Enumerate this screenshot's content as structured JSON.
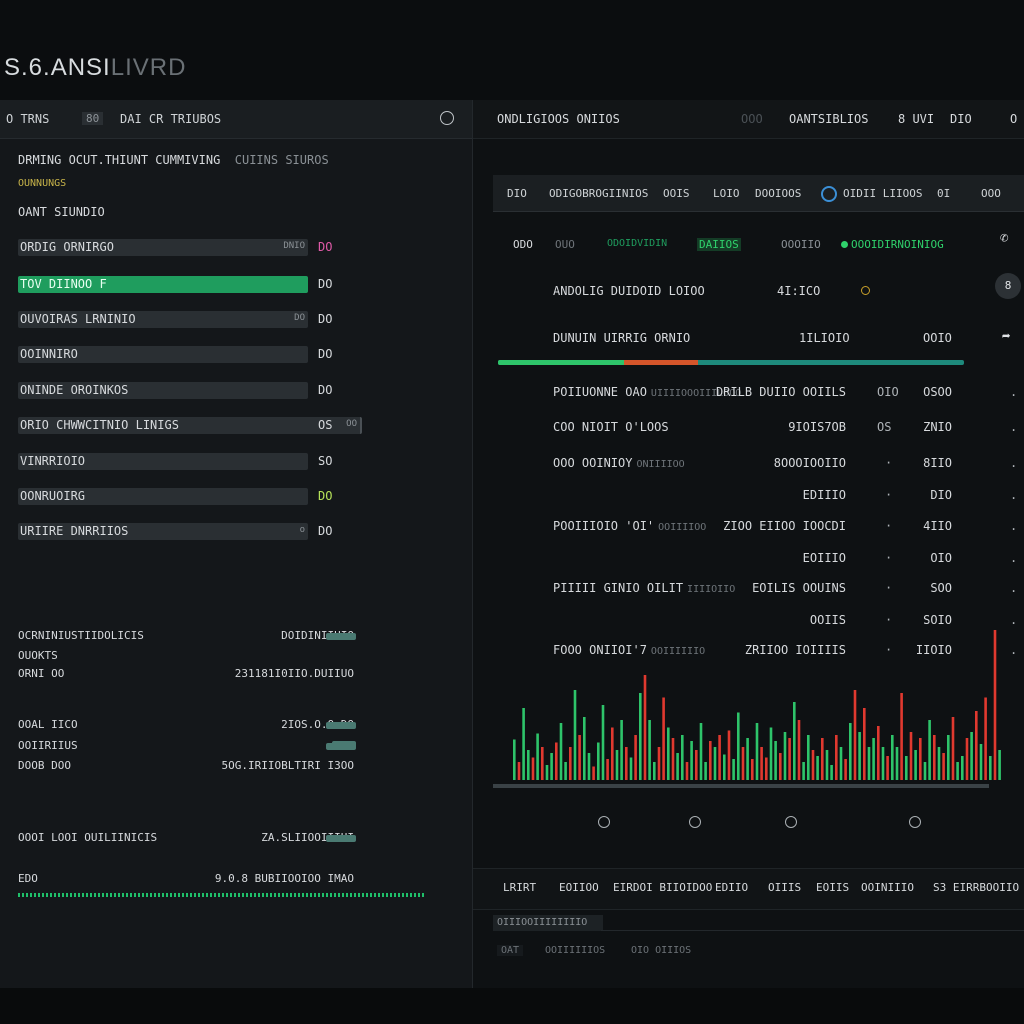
{
  "app": {
    "title": "S.6.ANSI",
    "title_faded": "LIVRD"
  },
  "left_panel": {
    "header": {
      "tab": "O TRNS",
      "badge": "80",
      "title": "DAI CR TRIUBOS",
      "icon": "gear-icon"
    },
    "heading": "DRMING OCUT.THIUNT CUMMIVING",
    "heading_extra": "CUIINS  SIUROS",
    "subheading": "OUNNUNGS",
    "section_title": "OANT SIUNDIO",
    "rows": [
      {
        "label": "ORDIG ORNIRGO",
        "sub": "DNIO",
        "value": "DO",
        "value_color": "pink"
      },
      {
        "label": "TOV DIINOO F",
        "sub": "",
        "value": "DO",
        "active": true
      },
      {
        "label": "OUVOIRAS LRNINIO",
        "sub": "DO",
        "value": "DO"
      },
      {
        "label": "OOINNIRO",
        "sub": "",
        "value": "DO"
      },
      {
        "label": "ONINDE OROINKOS",
        "sub": "",
        "value": "DO"
      },
      {
        "label": "ORIO CHWWCITNIO LINIGS",
        "sub": "OO",
        "value": "OS"
      },
      {
        "label": "VINRRIOIO",
        "sub": "",
        "value": "SO"
      },
      {
        "label": "OONRUOIRG",
        "sub": "",
        "value": "DO",
        "value_color": "lime"
      },
      {
        "label": "URIIRE DNRRIIOS",
        "sub": "o",
        "value": "DO"
      }
    ],
    "stats": [
      {
        "label": "OCRNINIUSTIIDOLICIS",
        "value": "DOIDINIIUIO"
      },
      {
        "label": "OUOKTS",
        "value": ""
      },
      {
        "label": "ORNI OO",
        "value": "231181I0IIO.DUIIUO"
      },
      {
        "label": "OOAL IICO",
        "value": "2IOS.O.O.DO"
      },
      {
        "label": "OOIIRIIUS",
        "value": ""
      },
      {
        "label": "DOOB DOO",
        "value": "5OG.IRIIOBLTIRI I3OO"
      },
      {
        "label": "OOOI LOOI OUILIINICIS",
        "value": "ZA.SLIIOOIIIUI"
      },
      {
        "label": "EDO",
        "value": "9.0.8  BUBIIOOIOO IMAO"
      }
    ]
  },
  "right_panel": {
    "header": {
      "title": "ONDLIGIOOS ONIIOS",
      "h2": "OOO",
      "h3": "OANTSIBLIOS",
      "h4": "8 UVI",
      "h5": "DIO",
      "h6": "O"
    },
    "tabs": [
      "DIO",
      "ODIGOBROGIINIOS",
      "OOIS",
      "LOIO",
      "DOOIOOS",
      "OIDII LIIOOS",
      "0I",
      "OOO"
    ],
    "filters": [
      "ODO",
      "OUO",
      "ODOIDVIDIN",
      "DAIIOS",
      "OOOIIO",
      "OOOIDIRNOINIOG"
    ],
    "summary": [
      {
        "label": "ANDOLIG DUIDOID LOIOO",
        "value": "4I:ICO"
      },
      {
        "label": "DUNUIN UIRRIG ORNIO",
        "value": "1ILIOIO",
        "value2": "OOIO"
      }
    ],
    "table": [
      {
        "name": "POIIUONNE OAO",
        "name_dim": "UIIIIOOOIIILOOO",
        "c1": "DRILB DUIIO OOIILS",
        "c2": "OIO",
        "c3": "OSOO"
      },
      {
        "name": "COO NIOIT O'LOOS",
        "name_dim": "",
        "c1": "9IOIS7OB",
        "c2": "OS",
        "c3": "ZNIO"
      },
      {
        "name": "OOO OOINIOY",
        "name_dim": "ONIIIIOO",
        "c1": "8OOOIOOIIO",
        "c2": "·",
        "c3": "8IIO"
      },
      {
        "name": "",
        "name_dim": "",
        "c1": "EDIIIO",
        "c2": "·",
        "c3": "DIO"
      },
      {
        "name": "POOIIIOIO 'OI'",
        "name_dim": "OOIIIIOO",
        "c1": "ZIOO  EIIOO IOOCDI",
        "c2": "·",
        "c3": "4IIO"
      },
      {
        "name": "",
        "name_dim": "",
        "c1": "EOIIIO",
        "c2": "·",
        "c3": "OIO"
      },
      {
        "name": "PIIIII GINIO OILIT",
        "name_dim": "IIIIOIIO",
        "c1": "EOILIS OOUINS",
        "c2": "·",
        "c3": "SOO"
      },
      {
        "name": "",
        "name_dim": "",
        "c1": "OOIIS",
        "c2": "·",
        "c3": "SOIO"
      },
      {
        "name": "FOOO ONIIOI'7",
        "name_dim": "OOIIIIIIO",
        "c1": "ZRIIOO IOIIIIS",
        "c2": "·",
        "c3": "IIOIO"
      }
    ],
    "progress": {
      "green": 0.27,
      "orange": 0.16,
      "teal": 0.57
    },
    "bottom_tabs": [
      "LRIRT",
      "EOIIOO",
      "EIRDOI BIIOIDOO",
      "EDIIO",
      "OIIIS",
      "EOIIS",
      "OOINIIIO",
      "S3  EIRRBOOIIO"
    ],
    "chip": "OIIIOOIIIIIIIIO",
    "footer": [
      "OAT",
      "OOIIIIIIOS",
      "OIO OIIIOS"
    ]
  },
  "colors": {
    "up": "#2ec46a",
    "down": "#e0392f",
    "accent": "#1f9d5e",
    "teal": "#1e8a7c",
    "orange": "#d4552a"
  },
  "chart_data": {
    "type": "bar",
    "title": "",
    "xlabel": "",
    "ylabel": "",
    "ylim": [
      0,
      100
    ],
    "values": [
      27,
      12,
      48,
      20,
      15,
      31,
      22,
      10,
      18,
      25,
      38,
      12,
      22,
      60,
      30,
      42,
      18,
      9,
      25,
      50,
      14,
      35,
      20,
      40,
      22,
      15,
      30,
      58,
      70,
      40,
      12,
      22,
      55,
      35,
      28,
      18,
      30,
      12,
      26,
      20,
      38,
      12,
      26,
      22,
      30,
      17,
      33,
      14,
      45,
      22,
      28,
      14,
      38,
      22,
      15,
      35,
      26,
      18,
      32,
      28,
      52,
      40,
      12,
      30,
      20,
      16,
      28,
      20,
      10,
      30,
      22,
      14,
      38,
      60,
      32,
      48,
      22,
      28,
      36,
      22,
      16,
      30,
      22,
      58,
      16,
      32,
      20,
      28,
      12,
      40,
      30,
      22,
      18,
      30,
      42,
      12,
      16,
      28,
      32,
      46,
      24,
      55,
      16,
      100,
      20
    ],
    "directions": "UDUUDUDUUDUUDUDUUDUUDDUUDUDUDUUDDUDUUDUDUUDUDUDUUDUDUDDUUDUDUDUUDUDUUDUDUDUDUUDUDUUDUDUDUUDUDUDUUDUDUDUD"
  }
}
